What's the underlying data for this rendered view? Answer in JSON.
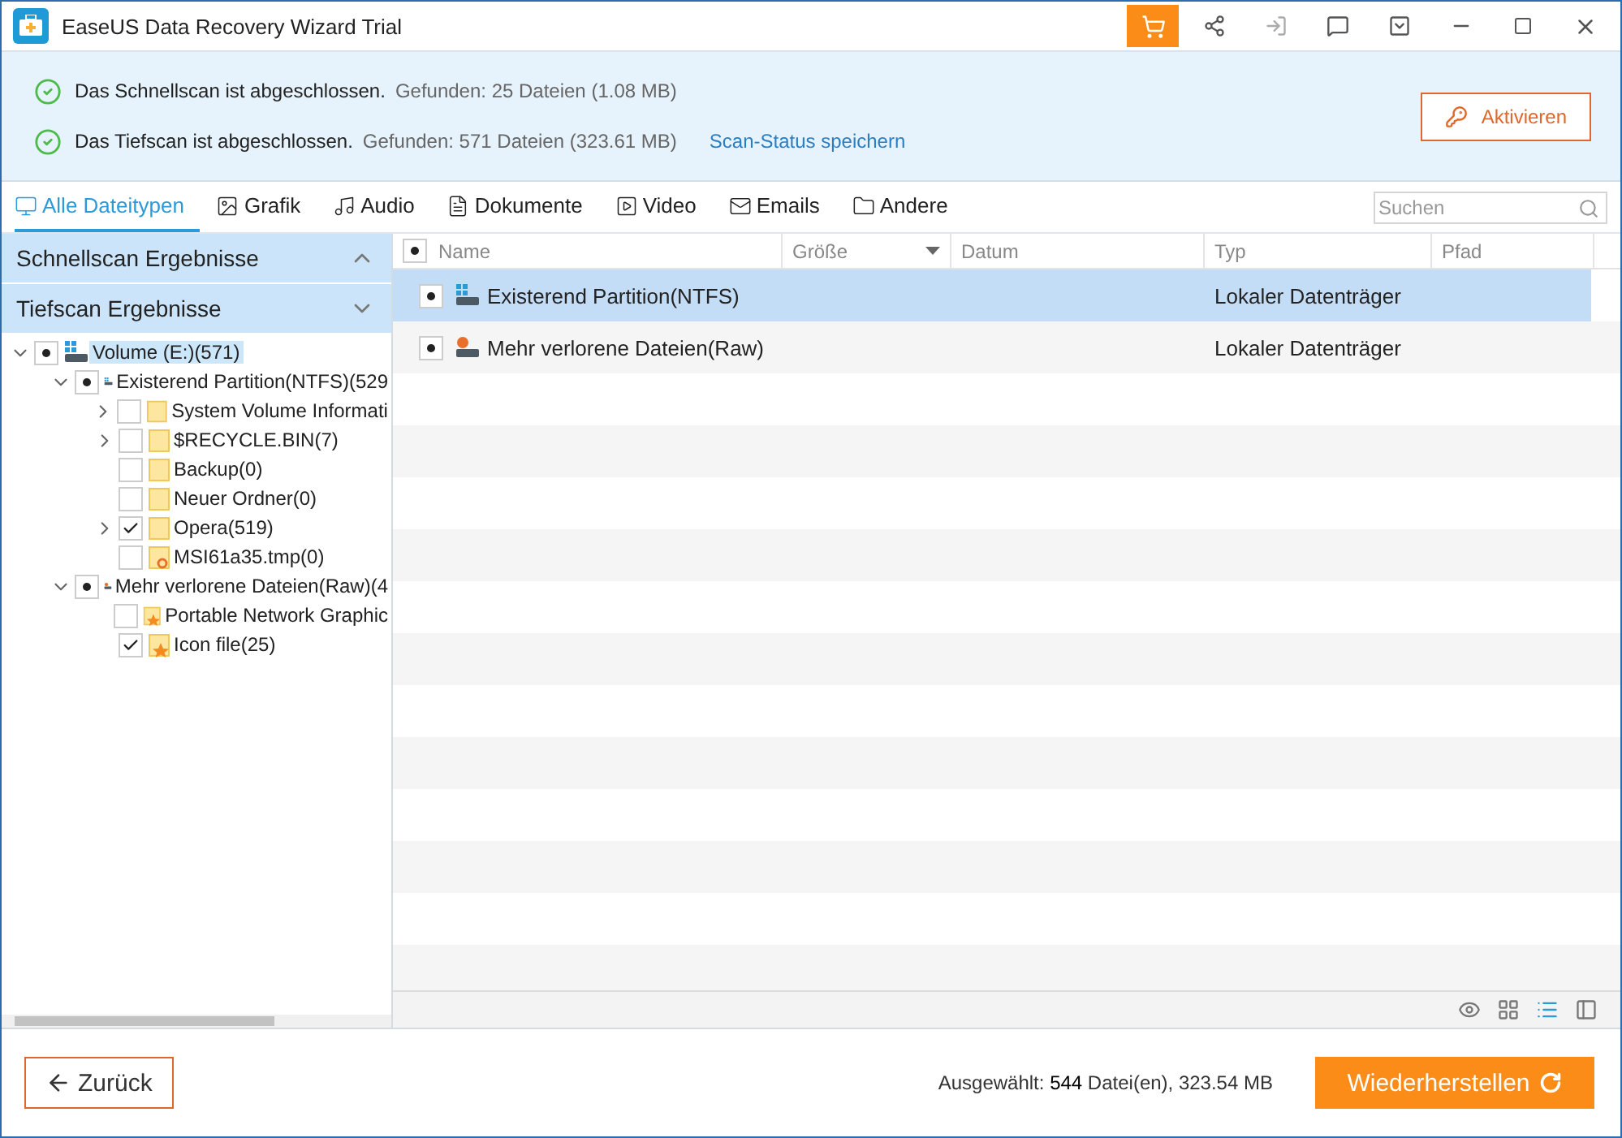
{
  "window": {
    "title": "EaseUS Data Recovery Wizard Trial"
  },
  "scan_status": [
    {
      "message": "Das Schnellscan ist abgeschlossen.",
      "found": "Gefunden: 25 Dateien (1.08 MB)"
    },
    {
      "message": "Das Tiefscan ist abgeschlossen.",
      "found": "Gefunden: 571 Dateien (323.61 MB)",
      "link": "Scan-Status speichern"
    }
  ],
  "activate_button": "Aktivieren",
  "tabs": [
    {
      "label": "Alle Dateitypen",
      "selected": true
    },
    {
      "label": "Grafik",
      "selected": false
    },
    {
      "label": "Audio",
      "selected": false
    },
    {
      "label": "Dokumente",
      "selected": false
    },
    {
      "label": "Video",
      "selected": false
    },
    {
      "label": "Emails",
      "selected": false
    },
    {
      "label": "Andere",
      "selected": false
    }
  ],
  "search": {
    "placeholder": "Suchen"
  },
  "sidebar": {
    "sections": [
      {
        "label": "Schnellscan Ergebnisse",
        "expanded": true
      },
      {
        "label": "Tiefscan Ergebnisse",
        "expanded": false
      }
    ],
    "tree": [
      {
        "label": "Volume (E:)(571)",
        "kind": "drive",
        "checked": true,
        "partial": true,
        "selected": true,
        "expanded": true,
        "children": [
          {
            "label": "Existerend Partition(NTFS)(529",
            "kind": "drive",
            "checked": true,
            "partial": true,
            "selected": false,
            "expanded": true,
            "children": [
              {
                "label": "System Volume Informati",
                "kind": "folder",
                "checked": false,
                "partial": false,
                "selected": false,
                "expanded": false
              },
              {
                "label": "$RECYCLE.BIN(7)",
                "kind": "folder",
                "checked": false,
                "partial": false,
                "selected": false,
                "expanded": false
              },
              {
                "label": "Backup(0)",
                "kind": "folder",
                "checked": false,
                "partial": false,
                "selected": false
              },
              {
                "label": "Neuer Ordner(0)",
                "kind": "folder",
                "checked": false,
                "partial": false,
                "selected": false
              },
              {
                "label": "Opera(519)",
                "kind": "folder",
                "checked": true,
                "partial": false,
                "selected": false,
                "expanded": false
              },
              {
                "label": "MSI61a35.tmp(0)",
                "kind": "file",
                "checked": false,
                "partial": false,
                "selected": false
              }
            ]
          },
          {
            "label": "Mehr verlorene Dateien(Raw)(4",
            "kind": "lost-drive",
            "checked": true,
            "partial": true,
            "selected": false,
            "expanded": true,
            "children": [
              {
                "label": "Portable Network Graphic",
                "kind": "starred",
                "checked": false,
                "partial": false,
                "selected": false
              },
              {
                "label": "Icon file(25)",
                "kind": "starred",
                "checked": true,
                "partial": false,
                "selected": false
              }
            ]
          }
        ]
      }
    ]
  },
  "table": {
    "check_all": {
      "checked": true,
      "partial": true
    },
    "columns": [
      {
        "label": "Name",
        "sorted": false
      },
      {
        "label": "Größe",
        "sorted": true
      },
      {
        "label": "Datum",
        "sorted": false
      },
      {
        "label": "Typ",
        "sorted": false
      },
      {
        "label": "Pfad",
        "sorted": false
      }
    ],
    "rows": [
      {
        "name": "Existerend Partition(NTFS)",
        "kind": "drive",
        "type": "Lokaler Datenträger",
        "checked": true,
        "partial": true,
        "selected": true
      },
      {
        "name": "Mehr verlorene Dateien(Raw)",
        "kind": "lost-drive",
        "type": "Lokaler Datenträger",
        "checked": true,
        "partial": true,
        "selected": false
      }
    ]
  },
  "views": [
    {
      "kind": "preview",
      "selected": false
    },
    {
      "kind": "thumbnails",
      "selected": false
    },
    {
      "kind": "list",
      "selected": true
    },
    {
      "kind": "details",
      "selected": false
    }
  ],
  "footer": {
    "back_button": "Zurück",
    "selection_label": "Ausgewählt: ",
    "selection_count": "544",
    "selection_rest": " Datei(en), 323.54 MB",
    "recover_button": "Wiederherstellen"
  }
}
